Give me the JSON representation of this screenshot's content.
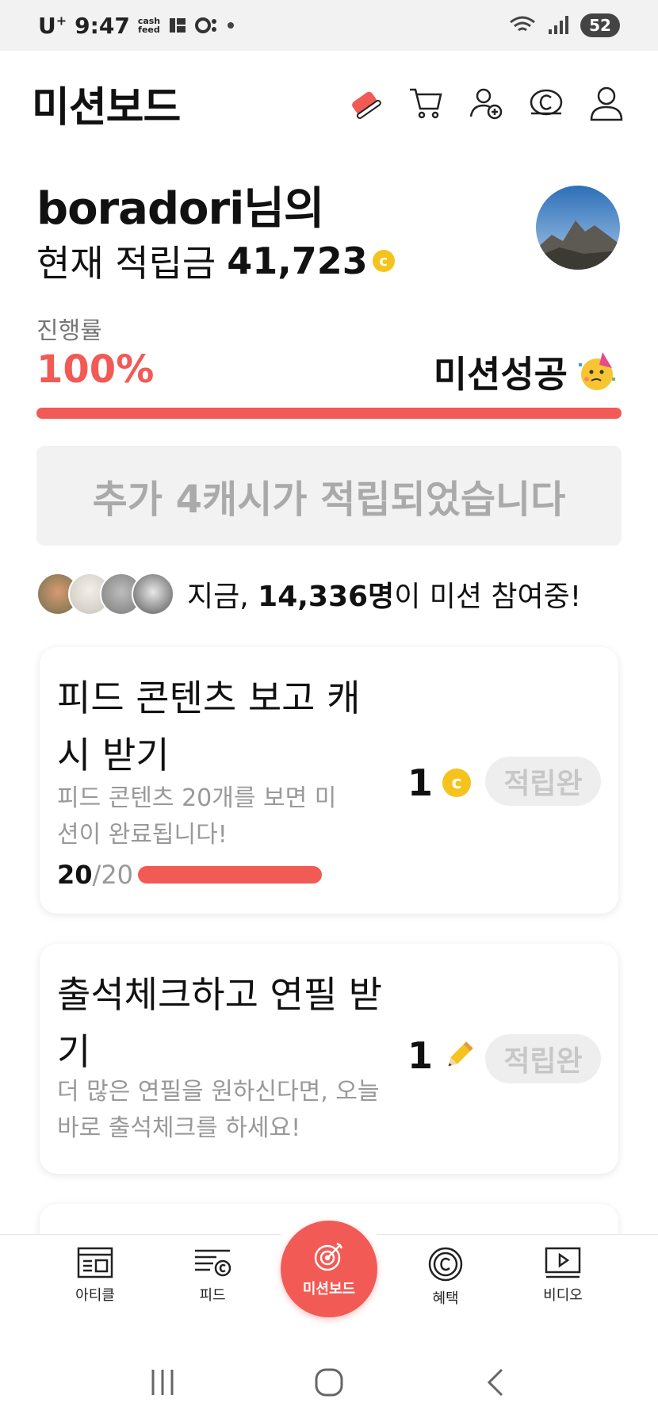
{
  "status_bar": {
    "carrier": "U",
    "carrier_sup": "+",
    "time": "9:47",
    "app_indicator_1": "cash",
    "app_indicator_2": "feed",
    "battery": "52"
  },
  "header": {
    "title": "미션보드"
  },
  "profile": {
    "greeting": "boradori님의",
    "balance_label": "현재 적립금",
    "balance_value": "41,723",
    "coin_symbol": "c"
  },
  "progress": {
    "label": "진행률",
    "percent_text": "100%",
    "percent_value": 100,
    "status": "미션성공"
  },
  "bonus": {
    "message": "추가 4캐시가 적립되었습니다"
  },
  "participants": {
    "prefix": "지금,",
    "count": "14,336명",
    "suffix": "이 미션 참여중!"
  },
  "missions": [
    {
      "title": "피드 콘텐츠 보고 캐시 받기",
      "description": "피드 콘텐츠 20개를 보면 미션이 완료됩니다!",
      "progress_done": "20",
      "progress_total": "/20",
      "progress_value": 1.0,
      "reward": "1",
      "reward_icon": "coin-icon",
      "status": "적립완"
    },
    {
      "title": "출석체크하고 연필 받기",
      "description": "더 많은 연필을 원하신다면, 오늘 바로 출석체크를 하세요!",
      "reward": "1",
      "reward_icon": "pencil-icon",
      "status": "적립완"
    }
  ],
  "bottom_nav": [
    {
      "label": "아티클",
      "icon": "article-icon"
    },
    {
      "label": "피드",
      "icon": "feed-icon"
    },
    {
      "label": "미션보드",
      "icon": "target-icon"
    },
    {
      "label": "혜택",
      "icon": "coin-circle-icon"
    },
    {
      "label": "비디오",
      "icon": "video-icon"
    }
  ],
  "colors": {
    "accent": "#f25a55",
    "coin": "#f6c21c",
    "muted": "#999999"
  }
}
